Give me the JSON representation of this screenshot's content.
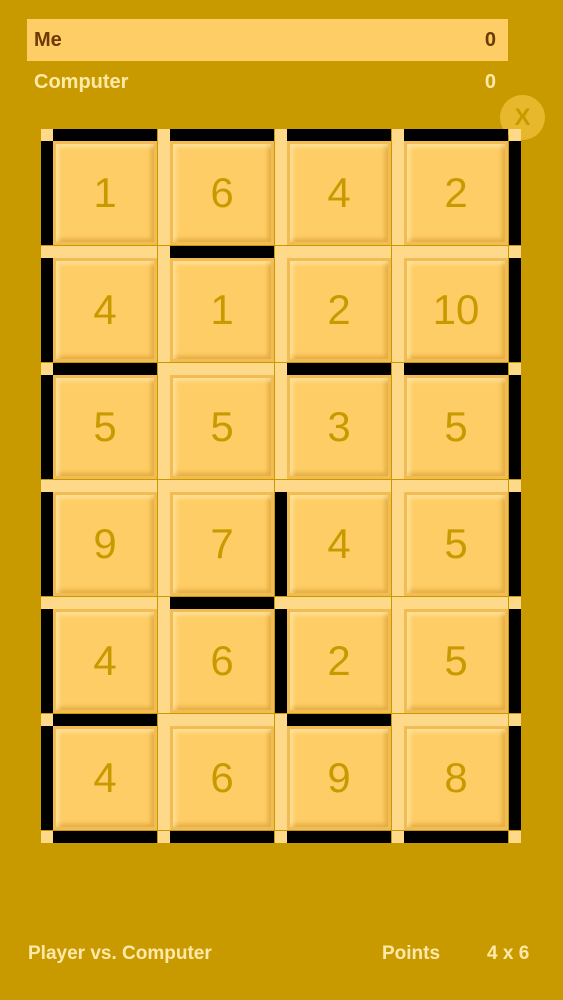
{
  "scoreboard": {
    "players": [
      {
        "name": "Me",
        "score": "0"
      },
      {
        "name": "Computer",
        "score": "0"
      }
    ]
  },
  "close_label": "X",
  "board": {
    "cols": 4,
    "rows": 6,
    "values": [
      [
        "1",
        "6",
        "4",
        "2"
      ],
      [
        "4",
        "1",
        "2",
        "10"
      ],
      [
        "5",
        "5",
        "3",
        "5"
      ],
      [
        "9",
        "7",
        "4",
        "5"
      ],
      [
        "4",
        "6",
        "2",
        "5"
      ],
      [
        "4",
        "6",
        "9",
        "8"
      ]
    ],
    "h_edges": [
      [
        1,
        1,
        1,
        1
      ],
      [
        0,
        1,
        0,
        0
      ],
      [
        1,
        0,
        1,
        1
      ],
      [
        0,
        0,
        0,
        0
      ],
      [
        0,
        1,
        0,
        0
      ],
      [
        1,
        0,
        1,
        0
      ],
      [
        1,
        1,
        1,
        1
      ]
    ],
    "v_edges": [
      [
        1,
        0,
        0,
        0,
        1
      ],
      [
        1,
        0,
        0,
        0,
        1
      ],
      [
        1,
        0,
        0,
        0,
        1
      ],
      [
        1,
        0,
        1,
        0,
        1
      ],
      [
        1,
        0,
        1,
        0,
        1
      ],
      [
        1,
        0,
        0,
        0,
        1
      ]
    ]
  },
  "footer": {
    "mode": "Player vs. Computer",
    "scoring": "Points",
    "size": "4 x 6"
  }
}
